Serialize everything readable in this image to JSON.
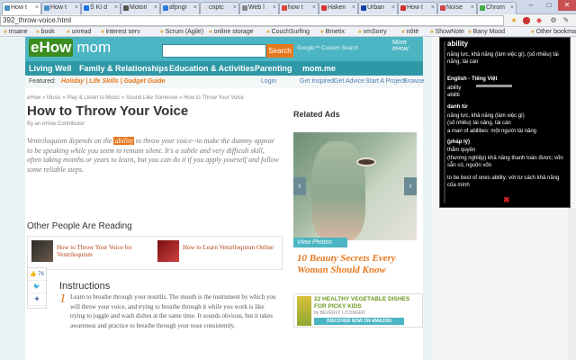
{
  "tabs": [
    {
      "label": "How t",
      "color": "#4a90c2",
      "active": true
    },
    {
      "label": "How t",
      "color": "#4a90c2"
    },
    {
      "label": "Ś Kí d",
      "color": "#1a73e8"
    },
    {
      "label": "Motori",
      "color": "#555"
    },
    {
      "label": "afpngr",
      "color": "#2b7ad9"
    },
    {
      "label": "cnptc",
      "color": "#e0e0e0"
    },
    {
      "label": "Web l",
      "color": "#888"
    },
    {
      "label": "how t",
      "color": "#dd4b39"
    },
    {
      "label": "Haken",
      "color": "#d33"
    },
    {
      "label": "Urban",
      "color": "#14a"
    },
    {
      "label": "How t",
      "color": "#c33"
    },
    {
      "label": "Noise",
      "color": "#c44"
    },
    {
      "label": "Chrom",
      "color": "#4a4"
    }
  ],
  "window_controls": {
    "minimize": "–",
    "maximize": "□",
    "close": "✕"
  },
  "address": {
    "url": "392_throw-voice.html"
  },
  "bookmarks": [
    "msane",
    "book",
    "unread",
    "interest serv",
    "Scrum (Agile)",
    "online storage",
    "CouchSurfing",
    "Bmetix",
    "vmSorry",
    "nôtë",
    "ShowNote",
    "Bany Mood"
  ],
  "other_bookmarks": "Other bookmarks",
  "site": {
    "logo_main": "eHow",
    "logo_sub": "mom",
    "search_button": "Search",
    "google_label": "Google™ Custom Search",
    "more_ehow": "More eHow",
    "nav": [
      "Living Well",
      "Family & Relationships",
      "Education & Activities",
      "Parenting",
      "mom.me"
    ],
    "featured_label": "Featured:",
    "featured_links": "Holiday | Life Skills | Gadget Guide",
    "util_links": [
      "Login",
      "Get Inspired",
      "Get Advice",
      "Start A Project",
      "Browse"
    ]
  },
  "article": {
    "breadcrumb": "eHow » Music » Play & Listen to Music » Sound Like Someone » How to Throw Your Voice",
    "title": "How to Throw Your Voice",
    "byline": "By an eHow Contributor",
    "intro_before": "Ventriloquism depends on the ",
    "intro_highlight": "ability",
    "intro_after": " to throw your voice--to make the dummy appear to be speaking while you seem to remain silent. It's a subtle and very difficult skill, often taking months or years to learn, but you can do it if you apply yourself and follow some reliable steps.",
    "also_reading_heading": "Other People Are Reading",
    "also_reading": [
      {
        "title": "How to Throw Your Voice for Ventriloquism"
      },
      {
        "title": "How to Learn Ventriloquism Online"
      }
    ],
    "instructions_heading": "Instructions",
    "step_number": "1",
    "step_text": "Learn to breathe through your nostrils. The mouth is the instrument by which you will throw your voice, and trying to breathe through it while you work is like trying to juggle and wash dishes at the same time. It sounds obvious, but it takes awareness and practice to breathe through your nose consistently."
  },
  "share": {
    "fb_count": "76"
  },
  "ads": {
    "heading": "Related Ads",
    "view_photos": "View Photos",
    "headline": "10 Beauty Secrets Every Woman Should Know",
    "book_title": "22 HEALTHY VEGETABLE DISHES FOR PICKY KIDS",
    "book_author": "by BEVERLY LITZINGER",
    "book_button": "DISCOVER NOW ON AMAZON"
  },
  "dictionary_popup": {
    "word": "ability",
    "summary": "năng lực, khả năng (làm việc gì), (số nhiều) tài năng, tài cán",
    "lang_pair": "English - Tiếng Việt",
    "pron1": "ability",
    "pron2": "əbiliti",
    "pos": "danh từ",
    "def1": "năng lực, khả năng (làm việc gì)",
    "def2": "(số nhiều) tài năng, tài cán",
    "ex1": "a man of abilities: một người tài năng",
    "law": "(pháp lý)",
    "def3": "thẩm quyền",
    "def4": "(thương nghiệp) khả năng thanh toán được; vốn sẵn có, nguồn vốn",
    "ex2": "to be best of ones ability: với tư cách khả năng của mình",
    "close": "✖"
  }
}
